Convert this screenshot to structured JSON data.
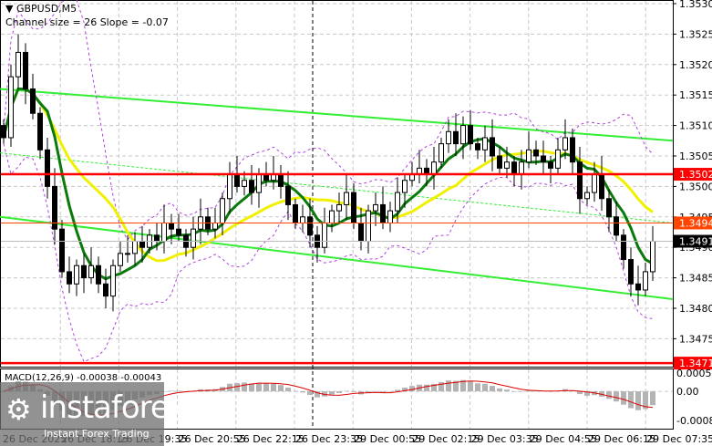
{
  "header": {
    "symbol": "GBPUSD,M5",
    "indicator": "Channel size = 26 Slope = -0.07"
  },
  "macd": {
    "label": "MACD(12,26,9) -0.00038 -0.00043",
    "axis": [
      "0.00051",
      "0.00",
      "-0.00081"
    ],
    "range": [
      -0.00081,
      0.00051
    ]
  },
  "watermark": {
    "brand": "instaforex",
    "tagline": "Instant Forex Trading"
  },
  "colors": {
    "support": "#ff0000",
    "level": "#ff4500",
    "channel": "#33ee33",
    "ma_fast": "#0a7a0a",
    "ma_slow": "#f0f000",
    "bands": "#b040e0"
  },
  "chart_data": {
    "type": "candlestick",
    "title": "GBPUSD,M5",
    "ylim": [
      1.3468,
      1.353
    ],
    "y_ticks": [
      "1.3530",
      "1.3525",
      "1.3520",
      "1.3515",
      "1.3510",
      "1.3505",
      "1.3500",
      "1.3495",
      "1.3490",
      "1.3485",
      "1.3480",
      "1.3475"
    ],
    "x_ticks": [
      "26 Dec 2025",
      "26 Dec 18:15",
      "26 Dec 19:35",
      "26 Dec 20:55",
      "26 Dec 22:15",
      "26 Dec 23:35",
      "29 Dec 00:55",
      "29 Dec 02:15",
      "29 Dec 03:35",
      "29 Dec 04:55",
      "29 Dec 06:15",
      "29 Dec 07:35"
    ],
    "levels": [
      {
        "price": 1.3502,
        "label": "1.3502",
        "color": "#ff0000"
      },
      {
        "price": 1.3494,
        "label": "1.3494",
        "color": "#ff4500"
      },
      {
        "price": 1.3471,
        "label": "1.3471",
        "color": "#ff0000"
      }
    ],
    "current_price": {
      "price": 1.3491,
      "label": "1.3491"
    },
    "channel": {
      "upper": [
        1.3516,
        1.35075
      ],
      "middle": [
        1.35055,
        1.3494
      ],
      "lower": [
        1.3495,
        1.34815
      ]
    },
    "close": [
      1.3508,
      1.3518,
      1.3522,
      1.3516,
      1.3512,
      1.3506,
      1.35,
      1.3493,
      1.3486,
      1.3484,
      1.3487,
      1.3485,
      1.3487,
      1.3484,
      1.3482,
      1.3487,
      1.3489,
      1.3489,
      1.3491,
      1.349,
      1.3492,
      1.3491,
      1.3494,
      1.3493,
      1.3492,
      1.349,
      1.3493,
      1.3495,
      1.3493,
      1.3494,
      1.3498,
      1.3502,
      1.35,
      1.3501,
      1.3499,
      1.3502,
      1.3501,
      1.3502,
      1.35,
      1.3497,
      1.3494,
      1.3495,
      1.3492,
      1.349,
      1.3494,
      1.3496,
      1.3497,
      1.3499,
      1.3494,
      1.3491,
      1.3496,
      1.3497,
      1.3494,
      1.3496,
      1.3499,
      1.3501,
      1.3502,
      1.3503,
      1.3502,
      1.3504,
      1.3507,
      1.3509,
      1.3507,
      1.351,
      1.3507,
      1.3506,
      1.3508,
      1.3505,
      1.3503,
      1.3504,
      1.3502,
      1.3504,
      1.3506,
      1.3505,
      1.3504,
      1.3503,
      1.3506,
      1.3508,
      1.3504,
      1.3498,
      1.3499,
      1.3502,
      1.3498,
      1.3495,
      1.3492,
      1.3488,
      1.3484,
      1.3483,
      1.3486,
      1.3491
    ]
  }
}
